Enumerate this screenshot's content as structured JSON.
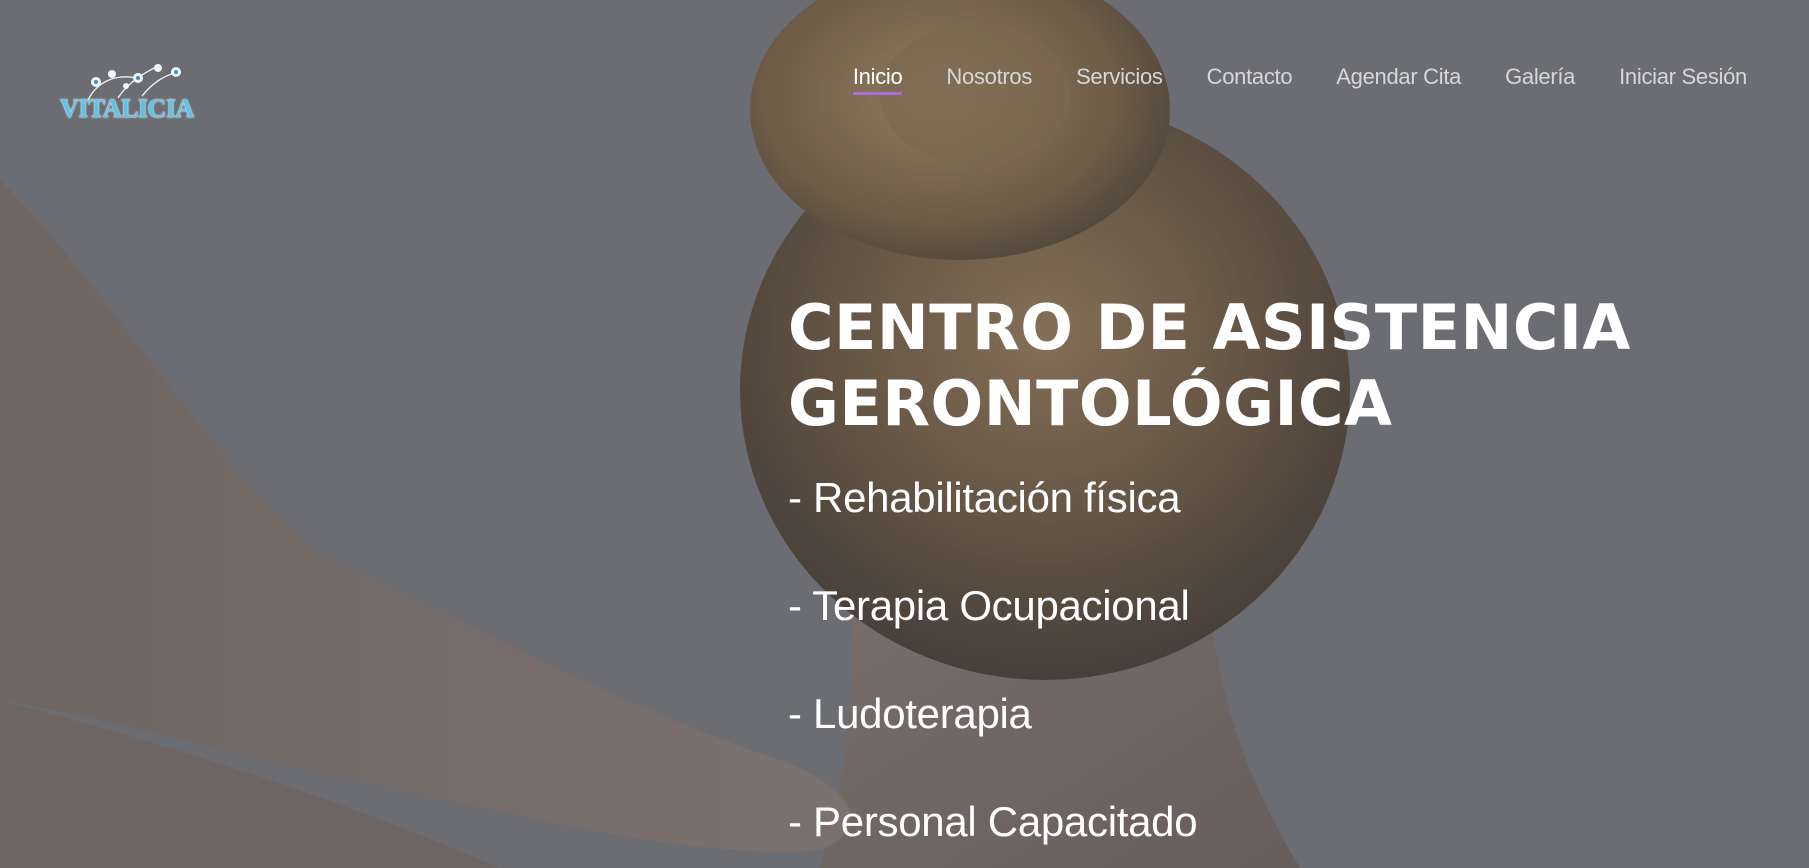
{
  "brand": {
    "logo_text": "VITALICIA",
    "logo_color": "#5ec3ea"
  },
  "nav": {
    "active_color": "#a86fd8",
    "items": [
      {
        "label": "Inicio",
        "active": true
      },
      {
        "label": "Nosotros",
        "active": false
      },
      {
        "label": "Servicios",
        "active": false
      },
      {
        "label": "Contacto",
        "active": false
      },
      {
        "label": "Agendar Cita",
        "active": false
      },
      {
        "label": "Galería",
        "active": false
      },
      {
        "label": "Iniciar Sesión",
        "active": false
      }
    ]
  },
  "hero": {
    "title_line1": "CENTRO DE ASISTENCIA",
    "title_line2": "GERONTOLÓGICA",
    "services": [
      "- Rehabilitación física",
      "- Terapia Ocupacional",
      "- Ludoterapia",
      "- Personal Capacitado"
    ]
  }
}
